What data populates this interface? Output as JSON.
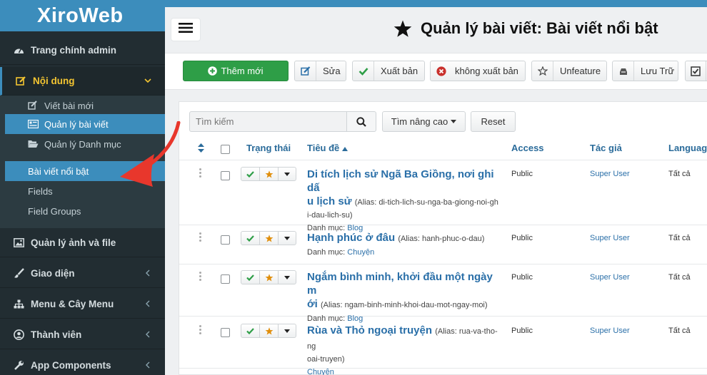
{
  "sidebar": {
    "logo": "XiroWeb",
    "items": [
      {
        "label": "Trang chính admin",
        "icon": "dashboard-icon"
      },
      {
        "label": "Nội dung",
        "icon": "edit-icon"
      },
      {
        "label": "Quản lý ảnh và file",
        "icon": "image-icon"
      },
      {
        "label": "Giao diện",
        "icon": "paint-brush-icon"
      },
      {
        "label": "Menu & Cây Menu",
        "icon": "sitemap-icon"
      },
      {
        "label": "Thành viên",
        "icon": "user-icon"
      },
      {
        "label": "App Components",
        "icon": "wrench-icon"
      }
    ],
    "sub_items": [
      {
        "label": "Viết bài mới",
        "icon": "pencil-square-icon"
      },
      {
        "label": "Quản lý bài viết",
        "icon": "list-icon"
      },
      {
        "label": "Quản lý Danh mục",
        "icon": "folder-open-icon"
      },
      {
        "label": "Bài viết nổi bật",
        "icon": ""
      },
      {
        "label": "Fields",
        "icon": ""
      },
      {
        "label": "Field Groups",
        "icon": ""
      }
    ]
  },
  "header": {
    "title": "Quản lý bài viết: Bài viết nổi bật"
  },
  "toolbar": {
    "new_label": "Thêm mới",
    "edit_label": "Sửa",
    "publish_label": "Xuất bản",
    "unpublish_label": "không xuất bản",
    "unfeature_label": "Unfeature",
    "archive_label": "Lưu Trữ"
  },
  "filters": {
    "search_placeholder": "Tìm kiếm",
    "advanced_label": "Tìm nâng cao",
    "reset_label": "Reset"
  },
  "table": {
    "headers": {
      "status": "Trạng thái",
      "title": "Tiêu đề",
      "access": "Access",
      "author": "Tác giả",
      "language": "Language"
    },
    "category_prefix": "Danh mục:",
    "rows": [
      {
        "title_lines": [
          "Di tích lịch sử Ngã Ba Giồng, nơi ghi dấ",
          "u lịch sử"
        ],
        "alias_inline": "(Alias: di-tich-lich-su-nga-ba-giong-noi-gh",
        "alias_rest": "i-dau-lich-su)",
        "category": "Blog",
        "access": "Public",
        "author": "Super User",
        "language": "Tất cả"
      },
      {
        "title_lines": [
          "Hạnh phúc ở đâu"
        ],
        "alias_inline": "(Alias: hanh-phuc-o-dau)",
        "alias_rest": "",
        "category": "Chuyện",
        "access": "Public",
        "author": "Super User",
        "language": "Tất cả"
      },
      {
        "title_lines": [
          "Ngắm bình minh, khởi đầu một ngày m",
          "ới"
        ],
        "alias_inline": "(Alias: ngam-binh-minh-khoi-dau-mot-ngay-moi)",
        "alias_rest": "",
        "category": "Blog",
        "access": "Public",
        "author": "Super User",
        "language": "Tất cả"
      },
      {
        "title_lines": [
          "Rùa và Thỏ ngoại truyện"
        ],
        "alias_inline": "(Alias: rua-va-tho-ng",
        "alias_rest": "oai-truyen)",
        "category": "Chuyện",
        "access": "Public",
        "author": "Super User",
        "language": "Tất cả"
      }
    ]
  },
  "colors": {
    "brand": "#3c8dbc",
    "sidebar": "#222d32",
    "success": "#2e9e47",
    "link": "#2a6fa8",
    "annotation": "#e8372c"
  }
}
